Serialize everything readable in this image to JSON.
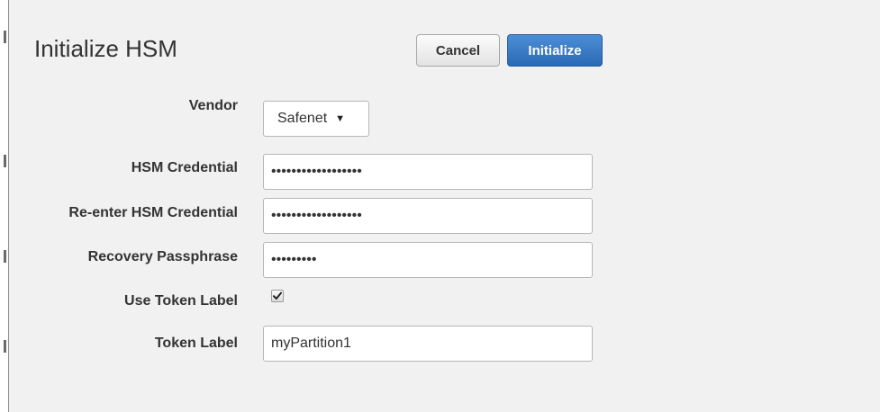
{
  "dialog": {
    "title": "Initialize HSM",
    "cancel_label": "Cancel",
    "initialize_label": "Initialize"
  },
  "form": {
    "vendor": {
      "label": "Vendor",
      "value": "Safenet",
      "icon": "chevron-down-icon"
    },
    "hsm_credential": {
      "label": "HSM Credential",
      "value": "••••••••••••••••••"
    },
    "reenter_hsm_credential": {
      "label": "Re-enter HSM Credential",
      "value": "••••••••••••••••••"
    },
    "recovery_passphrase": {
      "label": "Recovery Passphrase",
      "value": "•••••••••"
    },
    "use_token_label": {
      "label": "Use Token Label",
      "checked": true,
      "icon": "checkmark-icon"
    },
    "token_label": {
      "label": "Token Label",
      "value": "myPartition1"
    }
  },
  "colors": {
    "primary_button": "#2a69b5",
    "dialog_background": "#f1f1f1",
    "text": "#333333"
  }
}
